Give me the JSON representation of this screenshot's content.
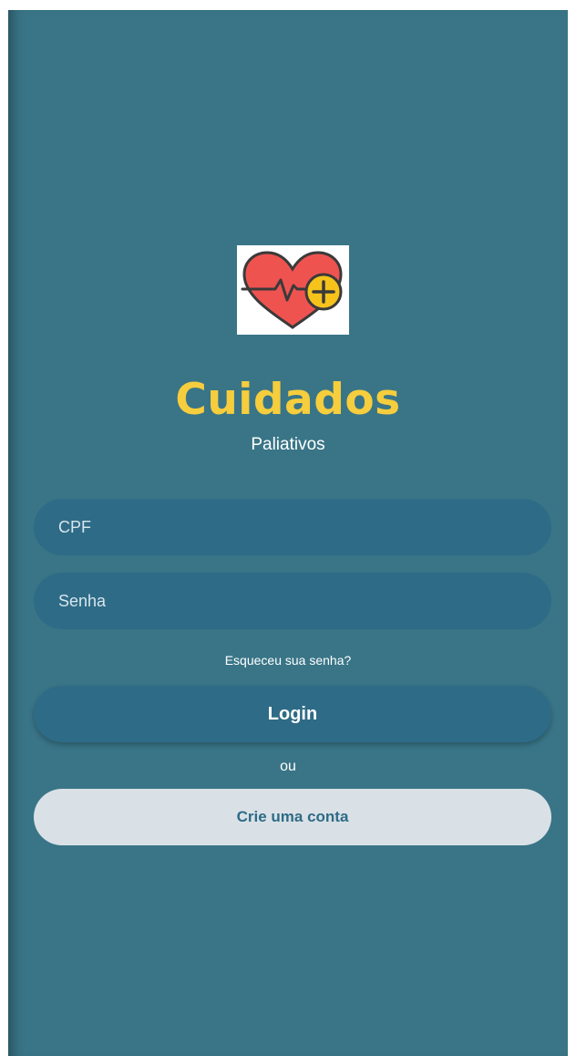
{
  "brand": {
    "title": "Cuidados",
    "subtitle": "Paliativos",
    "logo_icon": "heart-pulse-plus-icon"
  },
  "form": {
    "cpf_placeholder": "CPF",
    "senha_placeholder": "Senha",
    "forgot_label": "Esqueceu sua senha?",
    "login_label": "Login",
    "or_label": "ou",
    "create_account_label": "Crie uma conta"
  },
  "colors": {
    "background": "#397587",
    "accent_yellow": "#f6cd3d",
    "input_bg": "#2e6b87",
    "secondary_button_bg": "#dae1e6",
    "heart_red": "#ef5350"
  }
}
